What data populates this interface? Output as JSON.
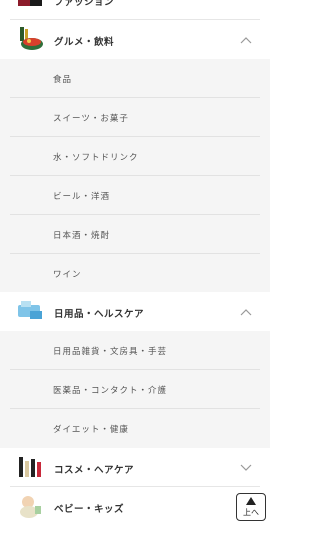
{
  "categories": {
    "top_partial": {
      "label": "ファッション"
    },
    "gourmet": {
      "label": "グルメ・飲料",
      "expanded": true,
      "items": [
        "食品",
        "スイーツ・お菓子",
        "水・ソフトドリンク",
        "ビール・洋酒",
        "日本酒・焼酎",
        "ワイン"
      ]
    },
    "daily": {
      "label": "日用品・ヘルスケア",
      "expanded": true,
      "items": [
        "日用品雑貨・文房具・手芸",
        "医薬品・コンタクト・介護",
        "ダイエット・健康"
      ]
    },
    "cosme": {
      "label": "コスメ・ヘアケア",
      "expanded": false
    },
    "baby": {
      "label": "ベビー・キッズ",
      "expanded": false
    }
  },
  "scroll_top_button": {
    "label": "上へ"
  },
  "colors": {
    "submenu_bg": "#f5f5f5",
    "divider": "#e6e6e6",
    "text": "#333333"
  }
}
